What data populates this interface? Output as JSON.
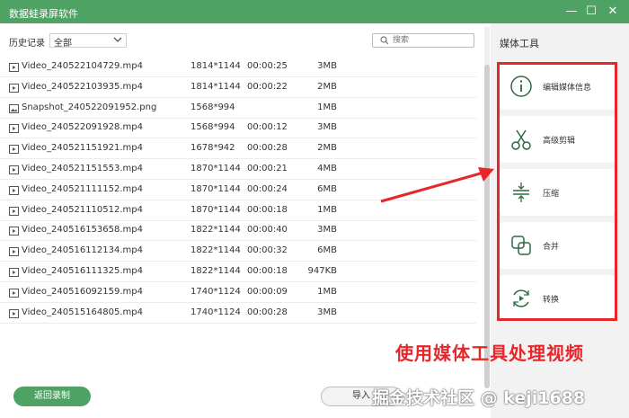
{
  "window": {
    "title": "数据蛙录屏软件",
    "minimize_glyph": "—",
    "maximize_glyph": "☐",
    "close_glyph": "✕"
  },
  "filter": {
    "label": "历史记录",
    "selected": "全部"
  },
  "search": {
    "placeholder": "搜索"
  },
  "files": [
    {
      "type": "video",
      "name": "Video_240522104729.mp4",
      "resolution": "1814*1144",
      "duration": "00:00:25",
      "size": "3MB"
    },
    {
      "type": "video",
      "name": "Video_240522103935.mp4",
      "resolution": "1814*1144",
      "duration": "00:00:22",
      "size": "2MB"
    },
    {
      "type": "image",
      "name": "Snapshot_240522091952.png",
      "resolution": "1568*994",
      "duration": "",
      "size": "1MB"
    },
    {
      "type": "video",
      "name": "Video_240522091928.mp4",
      "resolution": "1568*994",
      "duration": "00:00:12",
      "size": "3MB"
    },
    {
      "type": "video",
      "name": "Video_240521151921.mp4",
      "resolution": "1678*942",
      "duration": "00:00:28",
      "size": "2MB"
    },
    {
      "type": "video",
      "name": "Video_240521151553.mp4",
      "resolution": "1870*1144",
      "duration": "00:00:21",
      "size": "4MB"
    },
    {
      "type": "video",
      "name": "Video_240521111152.mp4",
      "resolution": "1870*1144",
      "duration": "00:00:24",
      "size": "6MB"
    },
    {
      "type": "video",
      "name": "Video_240521110512.mp4",
      "resolution": "1870*1144",
      "duration": "00:00:18",
      "size": "1MB"
    },
    {
      "type": "video",
      "name": "Video_240516153658.mp4",
      "resolution": "1822*1144",
      "duration": "00:00:40",
      "size": "3MB"
    },
    {
      "type": "video",
      "name": "Video_240516112134.mp4",
      "resolution": "1822*1144",
      "duration": "00:00:32",
      "size": "6MB"
    },
    {
      "type": "video",
      "name": "Video_240516111325.mp4",
      "resolution": "1822*1144",
      "duration": "00:00:18",
      "size": "947KB"
    },
    {
      "type": "video",
      "name": "Video_240516092159.mp4",
      "resolution": "1740*1124",
      "duration": "00:00:09",
      "size": "1MB"
    },
    {
      "type": "video",
      "name": "Video_240515164805.mp4",
      "resolution": "1740*1124",
      "duration": "00:00:28",
      "size": "3MB"
    }
  ],
  "buttons": {
    "back": "返回录制",
    "import": "导入"
  },
  "media_tools": {
    "title": "媒体工具",
    "items": [
      {
        "label": "编辑媒体信息",
        "icon": "info-icon"
      },
      {
        "label": "高级剪辑",
        "icon": "scissors-icon"
      },
      {
        "label": "压缩",
        "icon": "compress-icon"
      },
      {
        "label": "合并",
        "icon": "merge-icon"
      },
      {
        "label": "转换",
        "icon": "convert-icon"
      }
    ]
  },
  "annotation": {
    "caption": "使用媒体工具处理视频",
    "watermark": "掘金技术社区 @ keji1688"
  },
  "colors": {
    "accent": "#4ea264",
    "annotation_red": "#e8262a",
    "panel_bg": "#f2f2f2"
  }
}
